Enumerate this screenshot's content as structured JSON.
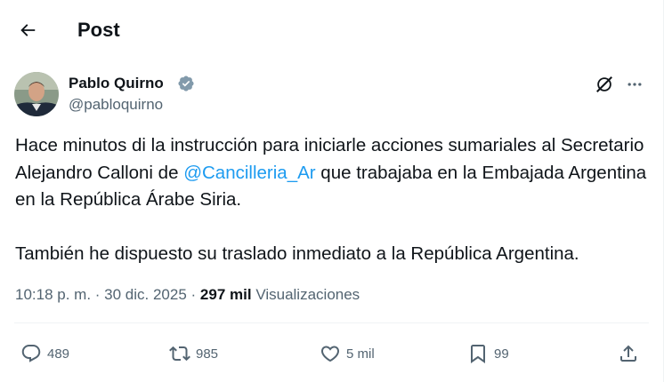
{
  "header": {
    "title": "Post"
  },
  "tweet": {
    "author_name": "Pablo Quirno",
    "handle": "@pabloquirno",
    "text_1a": "Hace minutos di la instrucción para iniciarle acciones sumariales al Secretario Alejandro Calloni de ",
    "mention": "@Cancilleria_Ar",
    "text_1b": " que trabajaba en la Embajada Argentina en la República Árabe Siria.",
    "text_2": "También he dispuesto su traslado inmediato a la República Argentina.",
    "time": "10:18 p. m.",
    "date": "30 dic. 2025",
    "views_count": "297 mil",
    "views_label": "Visualizaciones"
  },
  "actions": {
    "replies": "489",
    "reposts": "985",
    "likes": "5 mil",
    "bookmarks": "99"
  },
  "icons": {
    "back": "arrow-left-icon",
    "verified": "verified-badge-icon",
    "grok": "grok-icon",
    "more": "more-horizontal-icon",
    "reply": "reply-icon",
    "repost": "repost-icon",
    "like": "heart-icon",
    "bookmark": "bookmark-icon",
    "share": "share-icon"
  },
  "colors": {
    "text": "#0f1419",
    "secondary": "#536471",
    "link": "#1d9bf0",
    "verified": "#829aab",
    "divider": "#eff3f4"
  }
}
